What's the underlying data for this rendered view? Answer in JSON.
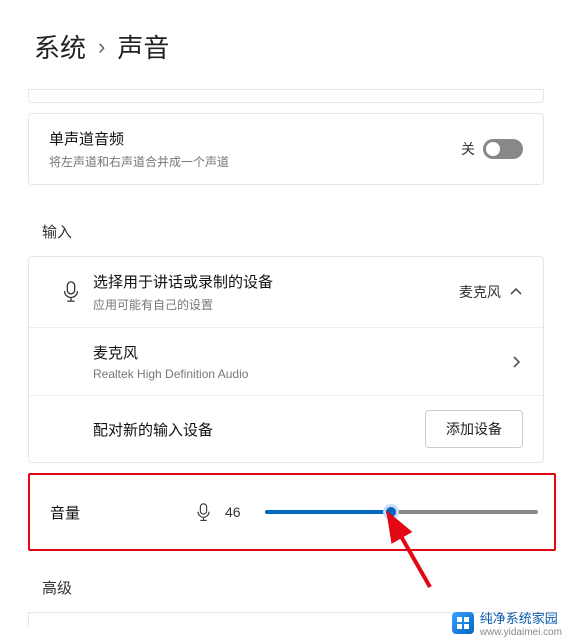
{
  "breadcrumb": {
    "root": "系统",
    "sep": "›",
    "current": "声音"
  },
  "mono_audio": {
    "title": "单声道音频",
    "sub": "将左声道和右声道合并成一个声道",
    "state_label": "关",
    "on": false
  },
  "input": {
    "section": "输入",
    "choose": {
      "title": "选择用于讲话或录制的设备",
      "sub": "应用可能有自己的设置",
      "selected": "麦克风"
    },
    "mic_device": {
      "title": "麦克风",
      "sub": "Realtek High Definition Audio"
    },
    "pair": {
      "title": "配对新的输入设备",
      "button": "添加设备"
    },
    "volume": {
      "label": "音量",
      "value": "46",
      "percent": 46
    }
  },
  "advanced": {
    "section": "高级"
  },
  "footer": {
    "brand": "纯净系统家园",
    "url": "www.yidaimei.com"
  }
}
